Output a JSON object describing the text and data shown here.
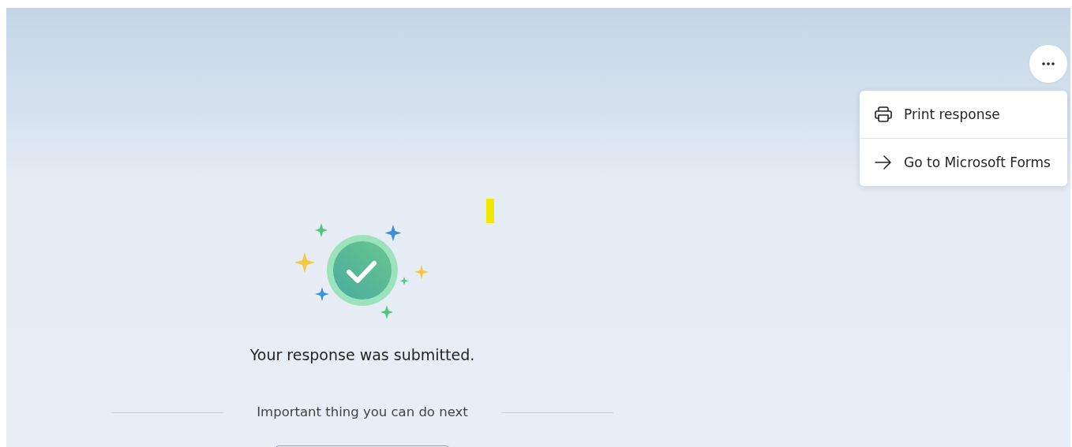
{
  "confirmation": {
    "message": "Your response was submitted."
  },
  "next_steps": {
    "heading": "Important thing you can do next"
  },
  "menu": {
    "expanded": true,
    "items": [
      {
        "label": "Print response",
        "kind": "print"
      },
      {
        "label": "Go to Microsoft Forms",
        "kind": "link"
      }
    ]
  }
}
